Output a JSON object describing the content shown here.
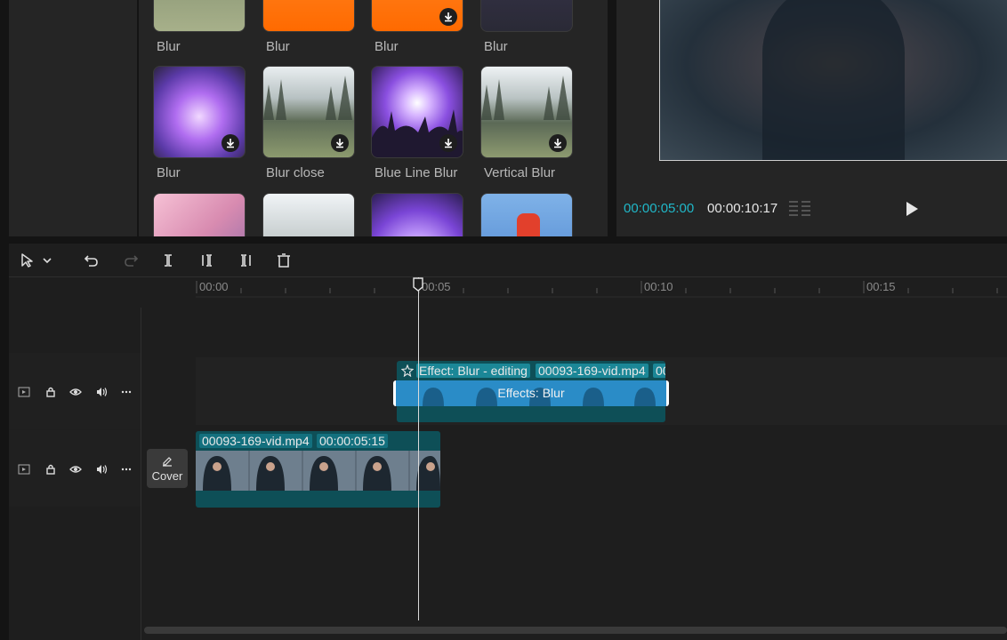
{
  "effects_panel": {
    "top_row_labels": [
      "Blur",
      "Blur",
      "Blur",
      "Blur"
    ],
    "middle_row": [
      {
        "label": "Blur",
        "downloadable": true
      },
      {
        "label": "Blur close",
        "downloadable": true
      },
      {
        "label": "Blue Line Blur",
        "downloadable": true
      },
      {
        "label": "Vertical Blur",
        "downloadable": true
      }
    ]
  },
  "player": {
    "current_time": "00:00:05:00",
    "total_time": "00:00:10:17"
  },
  "toolbar": {
    "tools": [
      "select-tool",
      "dropdown",
      "undo",
      "redo",
      "split",
      "split-left",
      "split-right",
      "delete"
    ]
  },
  "timeline": {
    "ruler_labels": [
      "00:00",
      "00:05",
      "00:10",
      "00:15"
    ],
    "effect_clip": {
      "tag": "Effect: Blur - editing",
      "file": "00093-169-vid.mp4",
      "overflow_text": "00",
      "bar_title": "Effects:  Blur"
    },
    "video_clip": {
      "file": "00093-169-vid.mp4",
      "duration": "00:00:05:15"
    },
    "cover_label": "Cover"
  },
  "colors": {
    "accent": "#20b7c8",
    "clip_bg": "#0e4f57",
    "effect_bar": "#2a8cc7"
  }
}
